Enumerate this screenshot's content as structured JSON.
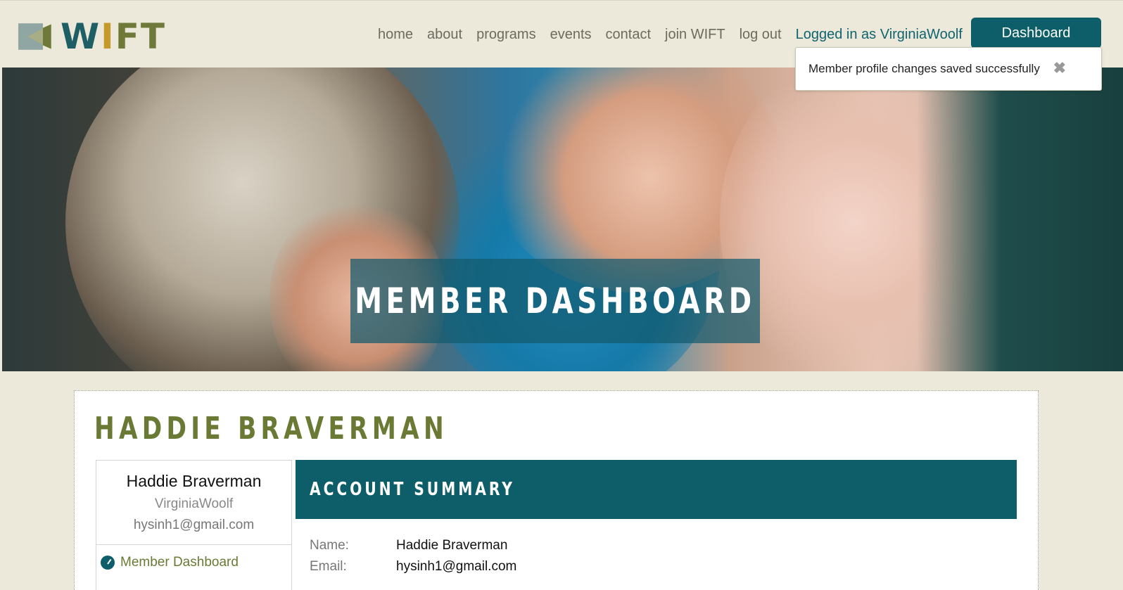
{
  "logo": {
    "text_w": "W",
    "text_i": "I",
    "text_ft": "FT"
  },
  "nav": {
    "items": [
      "home",
      "about",
      "programs",
      "events",
      "contact",
      "join WIFT",
      "log out"
    ],
    "logged_in": "Logged in as VirginiaWoolf",
    "dashboard_button": "Dashboard"
  },
  "toast": {
    "message": "Member profile changes saved successfully",
    "close": "✖"
  },
  "hero": {
    "title": "MEMBER DASHBOARD"
  },
  "member": {
    "heading": "HADDIE BRAVERMAN",
    "profile": {
      "name": "Haddie Braverman",
      "username": "VirginiaWoolf",
      "email": "hysinh1@gmail.com"
    },
    "side_link": "Member Dashboard"
  },
  "summary": {
    "title": "ACCOUNT SUMMARY",
    "rows": [
      {
        "label": "Name:",
        "value": "Haddie Braverman"
      },
      {
        "label": "Email:",
        "value": "hysinh1@gmail.com"
      }
    ]
  },
  "colors": {
    "brand_teal": "#0d5e68",
    "olive": "#6a7a35",
    "background": "#ede9da"
  }
}
